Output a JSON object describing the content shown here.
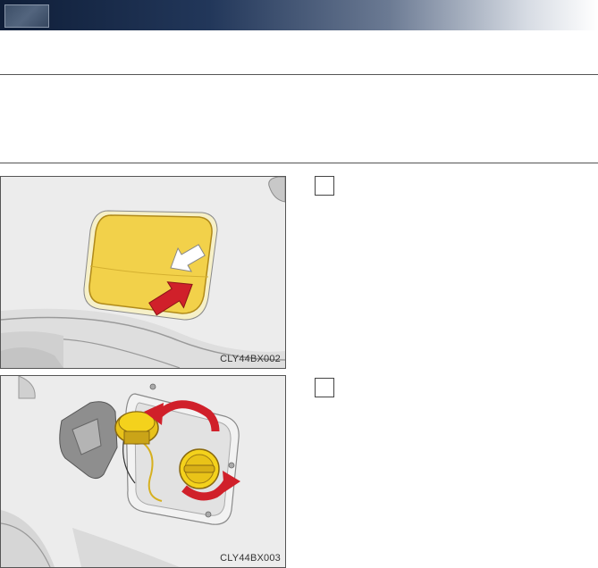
{
  "figures": [
    {
      "code": "CLY44BX002",
      "subject": "fuel-door",
      "arrows": [
        "push",
        "open"
      ]
    },
    {
      "code": "CLY44BX003",
      "subject": "fuel-cap",
      "arrows": [
        "rotate",
        "rotate"
      ]
    }
  ],
  "colors": {
    "header_dark": "#0f1e38",
    "fuel_door_yellow": "#f2d14a",
    "fuel_cap_yellow": "#f4d21c",
    "arrow_red": "#d0202a",
    "body_panel": "#e9e9e9"
  }
}
